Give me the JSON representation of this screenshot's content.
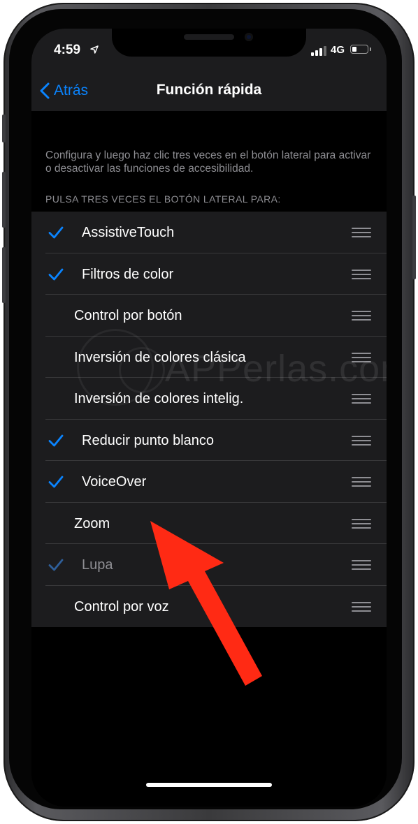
{
  "status_bar": {
    "time": "4:59",
    "network": "4G",
    "battery_level": 0.3
  },
  "nav": {
    "back_label": "Atrás",
    "title": "Función rápida"
  },
  "description": "Configura y luego haz clic tres veces en el botón lateral para activar o desactivar las funciones de accesibilidad.",
  "section_header": "PULSA TRES VECES EL BOTÓN LATERAL PARA:",
  "items": [
    {
      "label": "AssistiveTouch",
      "checked": true,
      "dimmed": false
    },
    {
      "label": "Filtros de color",
      "checked": true,
      "dimmed": false
    },
    {
      "label": "Control por botón",
      "checked": false,
      "dimmed": false
    },
    {
      "label": "Inversión de colores clásica",
      "checked": false,
      "dimmed": false
    },
    {
      "label": "Inversión de colores intelig.",
      "checked": false,
      "dimmed": false
    },
    {
      "label": "Reducir punto blanco",
      "checked": true,
      "dimmed": false
    },
    {
      "label": "VoiceOver",
      "checked": true,
      "dimmed": false
    },
    {
      "label": "Zoom",
      "checked": false,
      "dimmed": false
    },
    {
      "label": "Lupa",
      "checked": true,
      "dimmed": true
    },
    {
      "label": "Control por voz",
      "checked": false,
      "dimmed": false
    }
  ],
  "watermark": "APPerlas.com",
  "colors": {
    "accent": "#0a84ff",
    "background": "#000000",
    "cell_background": "#1c1c1e",
    "secondary_text": "#8e8e93",
    "annotation_arrow": "#ff2a14"
  },
  "icons": {
    "back": "chevron-left-icon",
    "check": "checkmark-icon",
    "reorder": "reorder-grip-icon",
    "location": "location-arrow-icon",
    "signal": "cellular-signal-icon",
    "battery": "battery-icon"
  }
}
